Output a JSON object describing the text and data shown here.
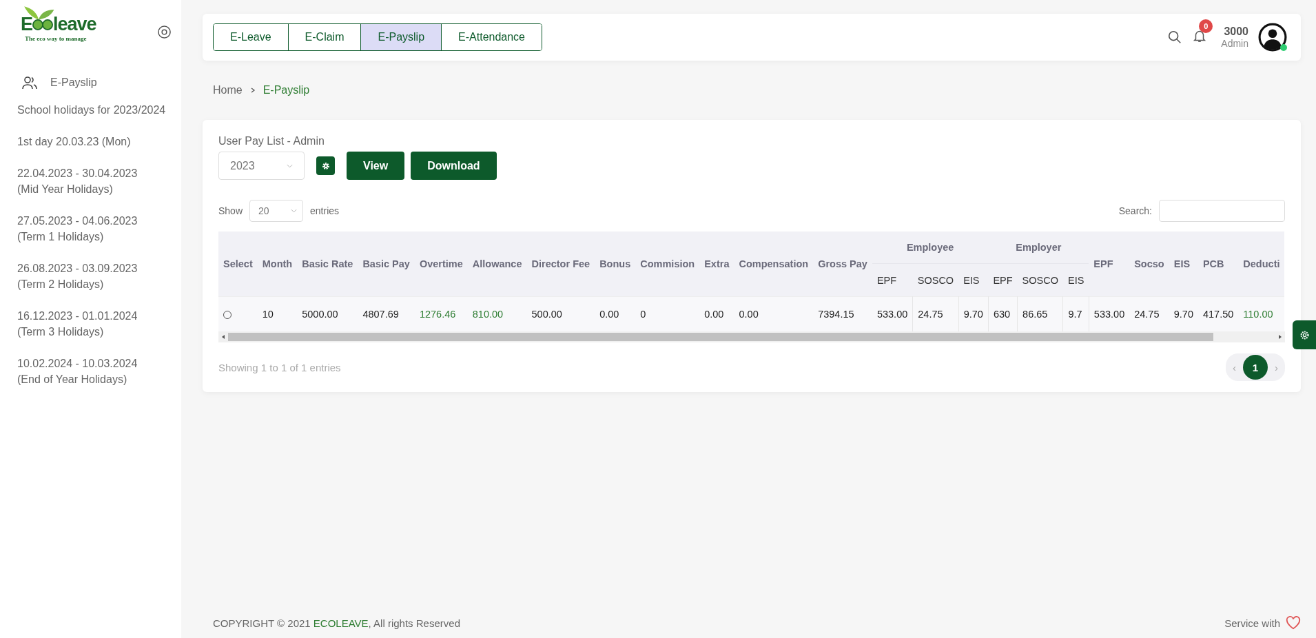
{
  "logo": {
    "mark": "E",
    "word": "leave",
    "tagline": "The eco way to manage"
  },
  "sidebar": {
    "menu": [
      {
        "label": "E-Payslip",
        "selected": false
      }
    ],
    "notes": [
      {
        "lines": [
          "School holidays for 2023/2024"
        ]
      },
      {
        "lines": [
          "1st day 20.03.23 (Mon)"
        ]
      },
      {
        "lines": [
          "22.04.2023 - 30.04.2023",
          "(Mid Year Holidays)"
        ]
      },
      {
        "lines": [
          "27.05.2023 - 04.06.2023",
          "(Term 1 Holidays)"
        ]
      },
      {
        "lines": [
          "26.08.2023 - 03.09.2023",
          "(Term 2 Holidays)"
        ]
      },
      {
        "lines": [
          "16.12.2023 - 01.01.2024",
          "(Term 3 Holidays)"
        ]
      },
      {
        "lines": [
          "10.02.2024 - 10.03.2024",
          "(End of Year Holidays)"
        ]
      }
    ]
  },
  "tabs": [
    {
      "label": "E-Leave",
      "selected": false
    },
    {
      "label": "E-Claim",
      "selected": false
    },
    {
      "label": "E-Payslip",
      "selected": true
    },
    {
      "label": "E-Attendance",
      "selected": false
    }
  ],
  "user": {
    "notifications": "0",
    "name": "3000",
    "role": "Admin",
    "online": true
  },
  "breadcrumb": [
    "Home",
    "E-Payslip"
  ],
  "card": {
    "title": "User Pay List - Admin",
    "year": "2023",
    "buttons": [
      "View",
      "Download"
    ]
  },
  "length": {
    "before": "Show",
    "value": "20",
    "after": "entries"
  },
  "search": {
    "label": "Search:"
  },
  "table": {
    "columns": [
      {
        "label": "Select"
      },
      {
        "label": "Month"
      },
      {
        "label": "Basic Rate"
      },
      {
        "label": "Basic Pay"
      },
      {
        "label": "Overtime"
      },
      {
        "label": "Allowance"
      },
      {
        "label": "Director Fee"
      },
      {
        "label": "Bonus"
      },
      {
        "label": "Commision"
      },
      {
        "label": "Extra"
      },
      {
        "label": "Compensation"
      },
      {
        "label": "Gross Pay"
      },
      {
        "label": "Employee",
        "colspan": 3,
        "children": [
          {
            "label": "EPF"
          },
          {
            "label": "SOSCO"
          },
          {
            "label": "EIS"
          }
        ]
      },
      {
        "label": "Employer",
        "colspan": 3,
        "children": [
          {
            "label": "EPF"
          },
          {
            "label": "SOSCO"
          },
          {
            "label": "EIS"
          }
        ]
      },
      {
        "label": "EPF"
      },
      {
        "label": "Socso"
      },
      {
        "label": "EIS"
      },
      {
        "label": "PCB"
      },
      {
        "label": "Deducti"
      }
    ],
    "rows": [
      {
        "cells": [
          {
            "kind": "radio",
            "selected": false
          },
          {
            "text": "10"
          },
          {
            "text": "5000.00"
          },
          {
            "text": "4807.69"
          },
          {
            "text": "1276.46",
            "color": "#2e7d32"
          },
          {
            "text": "810.00",
            "color": "#2e7d32"
          },
          {
            "text": "500.00"
          },
          {
            "text": "0.00"
          },
          {
            "text": "0"
          },
          {
            "text": "0.00"
          },
          {
            "text": "0.00"
          },
          {
            "text": "7394.15"
          },
          {
            "text": "533.00"
          },
          {
            "text": "24.75"
          },
          {
            "text": "9.70"
          },
          {
            "text": "630"
          },
          {
            "text": "86.65"
          },
          {
            "text": "9.7"
          },
          {
            "text": "533.00"
          },
          {
            "text": "24.75"
          },
          {
            "text": "9.70"
          },
          {
            "text": "417.50"
          },
          {
            "text": "110.00",
            "color": "#2e7d32"
          }
        ]
      }
    ]
  },
  "info": "Showing 1 to 1 of 1 entries",
  "pagination": {
    "prev": "‹",
    "pages": [
      {
        "label": "1",
        "selected": true
      }
    ],
    "next": "›"
  },
  "footer": {
    "before": "COPYRIGHT © 2021 ",
    "brand": "ECOLEAVE",
    "after": ", All rights Reserved",
    "service": "Service with"
  }
}
